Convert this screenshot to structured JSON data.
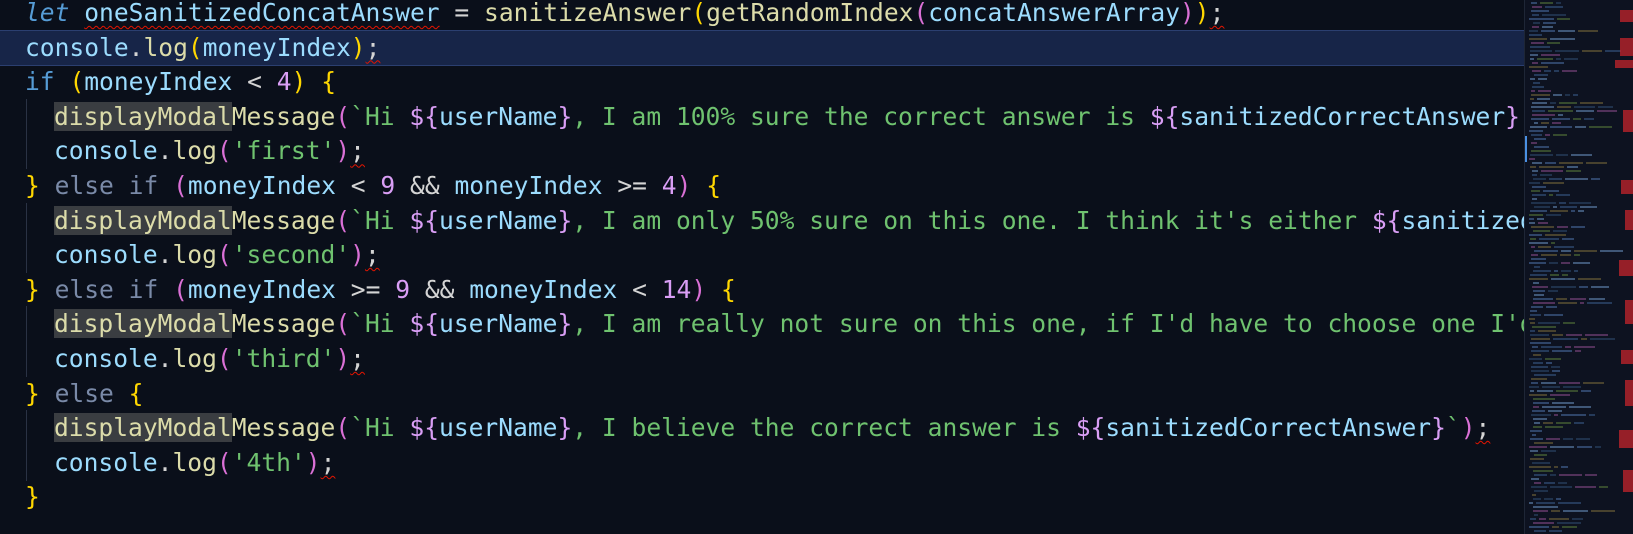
{
  "editor": {
    "language": "javascript",
    "current_line_index": 1,
    "lines": [
      {
        "indent": 0,
        "tokens": [
          {
            "t": "let",
            "c": "kw-italic"
          },
          {
            "t": " ",
            "c": "plain"
          },
          {
            "t": "oneSanitizedConcatAnswer",
            "c": "ident squig"
          },
          {
            "t": " = ",
            "c": "op"
          },
          {
            "t": "sanitizeAnswer",
            "c": "fn"
          },
          {
            "t": "(",
            "c": "paren1"
          },
          {
            "t": "getRandomIndex",
            "c": "fn"
          },
          {
            "t": "(",
            "c": "paren2"
          },
          {
            "t": "concatAnswerArray",
            "c": "ident"
          },
          {
            "t": ")",
            "c": "paren2"
          },
          {
            "t": ")",
            "c": "paren1"
          },
          {
            "t": ";",
            "c": "op squig"
          }
        ]
      },
      {
        "indent": 0,
        "tokens": [
          {
            "t": "console",
            "c": "ident"
          },
          {
            "t": ".",
            "c": "op"
          },
          {
            "t": "log",
            "c": "fn"
          },
          {
            "t": "(",
            "c": "paren1"
          },
          {
            "t": "moneyIndex",
            "c": "ident"
          },
          {
            "t": ")",
            "c": "paren1"
          },
          {
            "t": ";",
            "c": "op squig"
          }
        ]
      },
      {
        "indent": 0,
        "tokens": [
          {
            "t": "if",
            "c": "kw-ctrl"
          },
          {
            "t": " ",
            "c": "plain"
          },
          {
            "t": "(",
            "c": "paren1"
          },
          {
            "t": "moneyIndex",
            "c": "ident"
          },
          {
            "t": " < ",
            "c": "op"
          },
          {
            "t": "4",
            "c": "num"
          },
          {
            "t": ")",
            "c": "paren1"
          },
          {
            "t": " ",
            "c": "plain"
          },
          {
            "t": "{",
            "c": "paren1"
          }
        ]
      },
      {
        "indent": 1,
        "tokens": [
          {
            "t": "displayModal",
            "c": "fn-hl"
          },
          {
            "t": "Message",
            "c": "fn"
          },
          {
            "t": "(",
            "c": "paren2"
          },
          {
            "t": "`Hi ",
            "c": "str"
          },
          {
            "t": "${",
            "c": "tpl-dollar"
          },
          {
            "t": "userName",
            "c": "ident"
          },
          {
            "t": "}",
            "c": "tpl-dollar"
          },
          {
            "t": ", I am 100% sure the correct answer is ",
            "c": "str"
          },
          {
            "t": "${",
            "c": "tpl-dollar"
          },
          {
            "t": "sanitizedCorrectAnswer",
            "c": "ident"
          },
          {
            "t": "}",
            "c": "tpl-dollar"
          },
          {
            "t": ".`",
            "c": "str"
          },
          {
            "t": ")",
            "c": "paren2"
          },
          {
            "t": ";",
            "c": "op squig"
          }
        ]
      },
      {
        "indent": 1,
        "tokens": [
          {
            "t": "console",
            "c": "ident"
          },
          {
            "t": ".",
            "c": "op"
          },
          {
            "t": "log",
            "c": "fn"
          },
          {
            "t": "(",
            "c": "paren2"
          },
          {
            "t": "'first'",
            "c": "str"
          },
          {
            "t": ")",
            "c": "paren2"
          },
          {
            "t": ";",
            "c": "op squig"
          }
        ]
      },
      {
        "indent": 0,
        "tokens": [
          {
            "t": "}",
            "c": "paren1"
          },
          {
            "t": " else if ",
            "c": "dim"
          },
          {
            "t": "(",
            "c": "paren2"
          },
          {
            "t": "moneyIndex",
            "c": "ident"
          },
          {
            "t": " < ",
            "c": "op"
          },
          {
            "t": "9",
            "c": "num"
          },
          {
            "t": " && ",
            "c": "op"
          },
          {
            "t": "moneyIndex",
            "c": "ident"
          },
          {
            "t": " >= ",
            "c": "op"
          },
          {
            "t": "4",
            "c": "num"
          },
          {
            "t": ")",
            "c": "paren2"
          },
          {
            "t": " ",
            "c": "plain"
          },
          {
            "t": "{",
            "c": "paren1"
          }
        ]
      },
      {
        "indent": 1,
        "tokens": [
          {
            "t": "displayModal",
            "c": "fn-hl"
          },
          {
            "t": "Message",
            "c": "fn"
          },
          {
            "t": "(",
            "c": "paren2"
          },
          {
            "t": "`Hi ",
            "c": "str"
          },
          {
            "t": "${",
            "c": "tpl-dollar"
          },
          {
            "t": "userName",
            "c": "ident"
          },
          {
            "t": "}",
            "c": "tpl-dollar"
          },
          {
            "t": ", I am only 50% sure on this one. I think it's either ",
            "c": "str"
          },
          {
            "t": "${",
            "c": "tpl-dollar"
          },
          {
            "t": "sanitizedCor",
            "c": "ident"
          }
        ]
      },
      {
        "indent": 1,
        "tokens": [
          {
            "t": "console",
            "c": "ident"
          },
          {
            "t": ".",
            "c": "op"
          },
          {
            "t": "log",
            "c": "fn"
          },
          {
            "t": "(",
            "c": "paren2"
          },
          {
            "t": "'second'",
            "c": "str"
          },
          {
            "t": ")",
            "c": "paren2"
          },
          {
            "t": ";",
            "c": "op squig"
          }
        ]
      },
      {
        "indent": 0,
        "tokens": [
          {
            "t": "}",
            "c": "paren1"
          },
          {
            "t": " else if ",
            "c": "dim"
          },
          {
            "t": "(",
            "c": "paren2"
          },
          {
            "t": "moneyIndex",
            "c": "ident"
          },
          {
            "t": " >= ",
            "c": "op"
          },
          {
            "t": "9",
            "c": "num"
          },
          {
            "t": " && ",
            "c": "op"
          },
          {
            "t": "moneyIndex",
            "c": "ident"
          },
          {
            "t": " < ",
            "c": "op"
          },
          {
            "t": "14",
            "c": "num"
          },
          {
            "t": ")",
            "c": "paren2"
          },
          {
            "t": " ",
            "c": "plain"
          },
          {
            "t": "{",
            "c": "paren1"
          }
        ]
      },
      {
        "indent": 1,
        "tokens": [
          {
            "t": "displayModal",
            "c": "fn-hl"
          },
          {
            "t": "Message",
            "c": "fn"
          },
          {
            "t": "(",
            "c": "paren2"
          },
          {
            "t": "`Hi ",
            "c": "str"
          },
          {
            "t": "${",
            "c": "tpl-dollar"
          },
          {
            "t": "userName",
            "c": "ident"
          },
          {
            "t": "}",
            "c": "tpl-dollar"
          },
          {
            "t": ", I am really not sure on this one, if I'd have to choose one I'd cho",
            "c": "str"
          }
        ]
      },
      {
        "indent": 1,
        "tokens": [
          {
            "t": "console",
            "c": "ident"
          },
          {
            "t": ".",
            "c": "op"
          },
          {
            "t": "log",
            "c": "fn"
          },
          {
            "t": "(",
            "c": "paren2"
          },
          {
            "t": "'third'",
            "c": "str"
          },
          {
            "t": ")",
            "c": "paren2"
          },
          {
            "t": ";",
            "c": "op squig"
          }
        ]
      },
      {
        "indent": 0,
        "tokens": [
          {
            "t": "}",
            "c": "paren1"
          },
          {
            "t": " else ",
            "c": "dim"
          },
          {
            "t": "{",
            "c": "paren1"
          }
        ]
      },
      {
        "indent": 1,
        "tokens": [
          {
            "t": "displayModal",
            "c": "fn-hl"
          },
          {
            "t": "Message",
            "c": "fn"
          },
          {
            "t": "(",
            "c": "paren2"
          },
          {
            "t": "`Hi ",
            "c": "str"
          },
          {
            "t": "${",
            "c": "tpl-dollar"
          },
          {
            "t": "userName",
            "c": "ident"
          },
          {
            "t": "}",
            "c": "tpl-dollar"
          },
          {
            "t": ", I believe the correct answer is ",
            "c": "str"
          },
          {
            "t": "${",
            "c": "tpl-dollar"
          },
          {
            "t": "sanitizedCorrectAnswer",
            "c": "ident"
          },
          {
            "t": "}",
            "c": "tpl-dollar"
          },
          {
            "t": "`",
            "c": "str"
          },
          {
            "t": ")",
            "c": "paren2"
          },
          {
            "t": ";",
            "c": "op squig"
          }
        ]
      },
      {
        "indent": 1,
        "tokens": [
          {
            "t": "console",
            "c": "ident"
          },
          {
            "t": ".",
            "c": "op"
          },
          {
            "t": "log",
            "c": "fn"
          },
          {
            "t": "(",
            "c": "paren2"
          },
          {
            "t": "'4th'",
            "c": "str"
          },
          {
            "t": ")",
            "c": "paren2"
          },
          {
            "t": ";",
            "c": "op squig"
          }
        ]
      },
      {
        "indent": 0,
        "tokens": [
          {
            "t": "}",
            "c": "paren1"
          }
        ]
      }
    ]
  },
  "colors": {
    "background": "#0a0f1a",
    "current_line": "#172548",
    "minimap_error": "#c4242b"
  }
}
